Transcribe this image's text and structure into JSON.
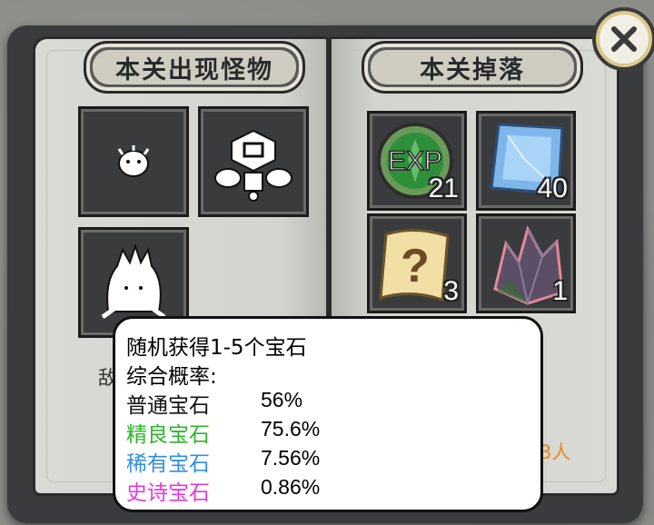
{
  "left_page": {
    "title": "本关出现怪物",
    "monsters": [
      {
        "icon": "puffball-monster-icon"
      },
      {
        "icon": "robot-monster-icon"
      },
      {
        "icon": "spiky-monster-icon"
      }
    ],
    "partial_text": "敌"
  },
  "right_page": {
    "title": "本关掉落",
    "drops": [
      {
        "icon": "exp-orb-icon",
        "count": "21"
      },
      {
        "icon": "blue-gem-icon",
        "count": "40"
      },
      {
        "icon": "mystery-scroll-icon",
        "count": "3"
      },
      {
        "icon": "crystal-cluster-icon",
        "count": "1"
      }
    ],
    "partial_text": "3人"
  },
  "close_button": {
    "icon": "close-icon"
  },
  "tooltip": {
    "title": "随机获得1-5个宝石",
    "subtitle": "综合概率:",
    "rows": [
      {
        "label": "普通宝石",
        "value": "56%",
        "color": "#111111"
      },
      {
        "label": "精良宝石",
        "value": "75.6%",
        "color": "#2db52d"
      },
      {
        "label": "稀有宝石",
        "value": "7.56%",
        "color": "#2f8fe0"
      },
      {
        "label": "史诗宝石",
        "value": "0.86%",
        "color": "#e23ad8"
      }
    ]
  }
}
